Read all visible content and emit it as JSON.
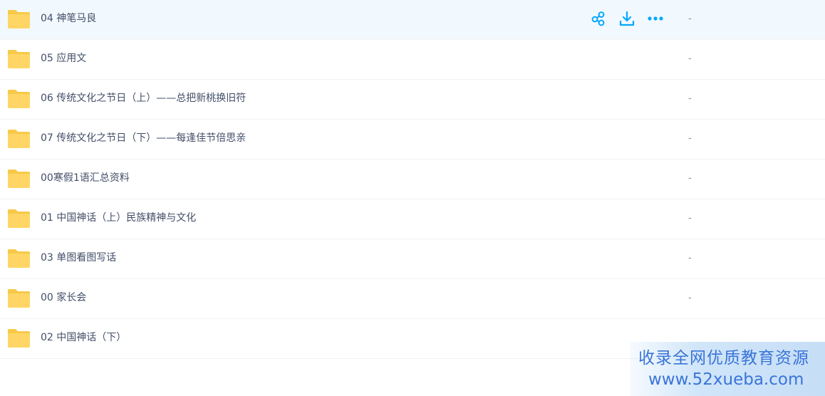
{
  "files": [
    {
      "name": "04 神笔马良",
      "size": "-",
      "hovered": true
    },
    {
      "name": "05 应用文",
      "size": "-"
    },
    {
      "name": "06 传统文化之节日（上）——总把新桃换旧符",
      "size": "-"
    },
    {
      "name": "07 传统文化之节日（下）——每逢佳节倍思亲",
      "size": "-"
    },
    {
      "name": "00寒假1语汇总资料",
      "size": "-"
    },
    {
      "name": "01 中国神话（上）民族精神与文化",
      "size": "-"
    },
    {
      "name": "03 单图看图写话",
      "size": "-"
    },
    {
      "name": "00 家长会",
      "size": "-"
    },
    {
      "name": "02 中国神话（下）",
      "size": ""
    }
  ],
  "row_actions": {
    "share_icon": "share-icon",
    "download_icon": "download-icon",
    "more_icon": "more-icon"
  },
  "colors": {
    "accent": "#06a7ff",
    "folder": "#ffd666",
    "folder_tab": "#f7c948",
    "text": "#424e67",
    "hover_bg": "#f2f9fe"
  },
  "watermark": {
    "line1": "收录全网优质教育资源",
    "line2": "www.52xueba.com"
  }
}
